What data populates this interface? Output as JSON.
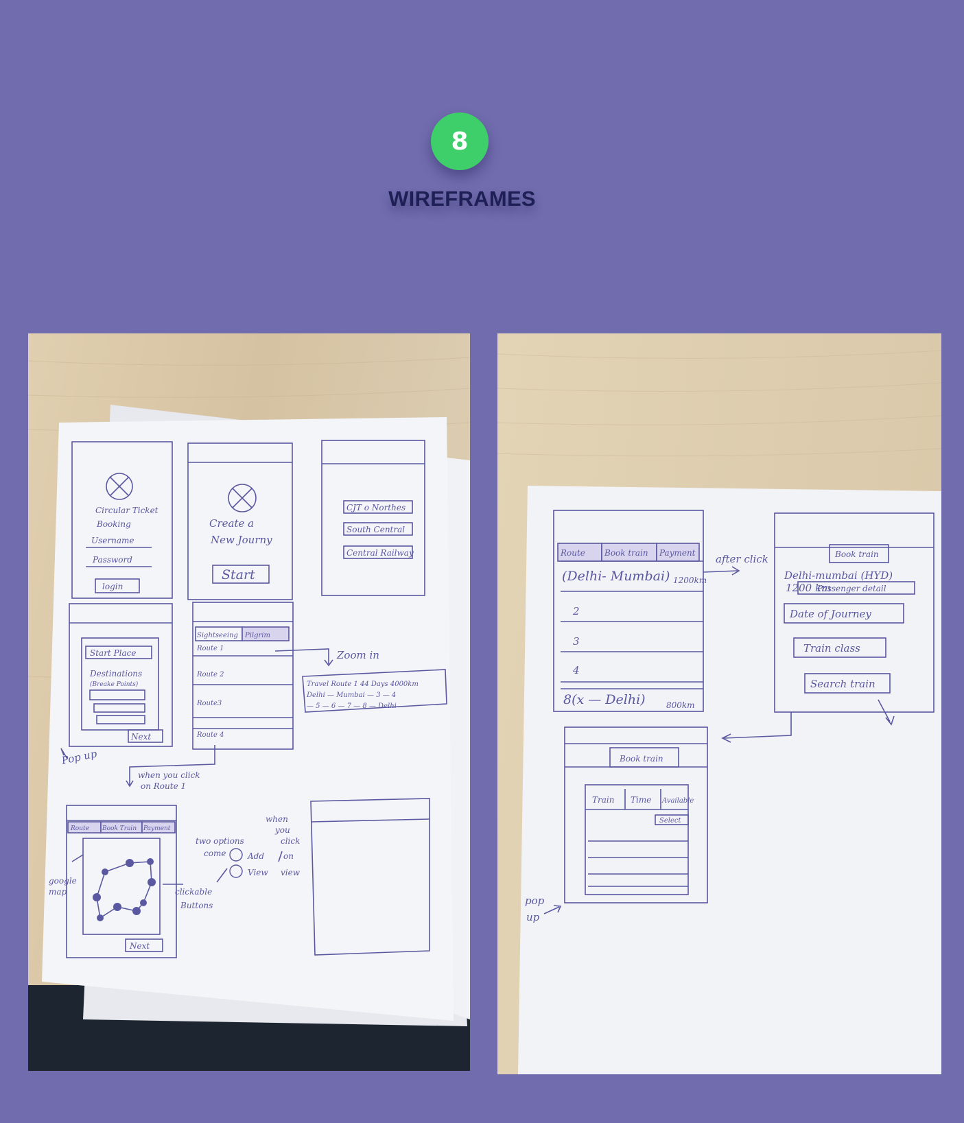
{
  "header": {
    "section_number": "8",
    "title": "WIREFRAMES"
  },
  "left_sheet": {
    "login": {
      "app_title_1": "Circular Ticket",
      "app_title_2": "Booking",
      "username": "Username",
      "password": "Password",
      "login_button": "login"
    },
    "create": {
      "line1": "Create a",
      "line2": "New Journy",
      "start_button": "Start"
    },
    "railways": [
      "CJT o Northes",
      "South Central",
      "Central Railway"
    ],
    "places": {
      "start_place": "Start Place",
      "destinations": "Destinations",
      "break_points": "(Breake Points)",
      "next_button": "Next"
    },
    "popup_note": "Pop up",
    "routes": {
      "tab_sightseeing": "Sightseeing",
      "tab_pilgrim": "Pilgrim",
      "items": [
        "Route 1",
        "Route 2",
        "Route3",
        "Route 4"
      ],
      "zoom_note": "Zoom in",
      "zoom_line1": "Travel Route 1   44 Days  4000km",
      "zoom_line2": "Delhi — Mumbai — 3 — 4",
      "zoom_line3": "— 5 — 6 — 7 — 8 — Delhi",
      "click_note_1": "when you click",
      "click_note_2": "on Route 1"
    },
    "map": {
      "tabs": [
        "Route",
        "Book Train",
        "Payment"
      ],
      "google_map_1": "google",
      "google_map_2": "map",
      "clickable_1": "clickable",
      "clickable_2": "Buttons",
      "options_1": "two options",
      "options_2": "come",
      "option_add": "Add",
      "option_view": "View",
      "when_1": "when",
      "when_2": "you",
      "when_3": "click",
      "when_4": "on",
      "when_5": "view",
      "next_button": "Next"
    }
  },
  "right_sheet": {
    "route_screen": {
      "tabs": [
        "Route",
        "Book train",
        "Payment"
      ],
      "row1": "(Delhi- Mumbai)",
      "row1_km": "1200km",
      "rows": [
        "2",
        "3",
        "4"
      ],
      "last_row": "8(x — Delhi)",
      "last_km": "800km"
    },
    "after_click": "after click",
    "book_screen": {
      "tab": "Book train",
      "route": "Delhi-mumbai (HYD)",
      "distance": "1200 km",
      "passenger": "Passenger detail",
      "date": "Date of Journey",
      "class": "Train class",
      "search": "Search train"
    },
    "popup_screen": {
      "tab": "Book train",
      "col_train": "Train",
      "col_time": "Time",
      "col_avail": "Available",
      "select": "Select"
    },
    "popup_note_1": "pop",
    "popup_note_2": "up"
  }
}
